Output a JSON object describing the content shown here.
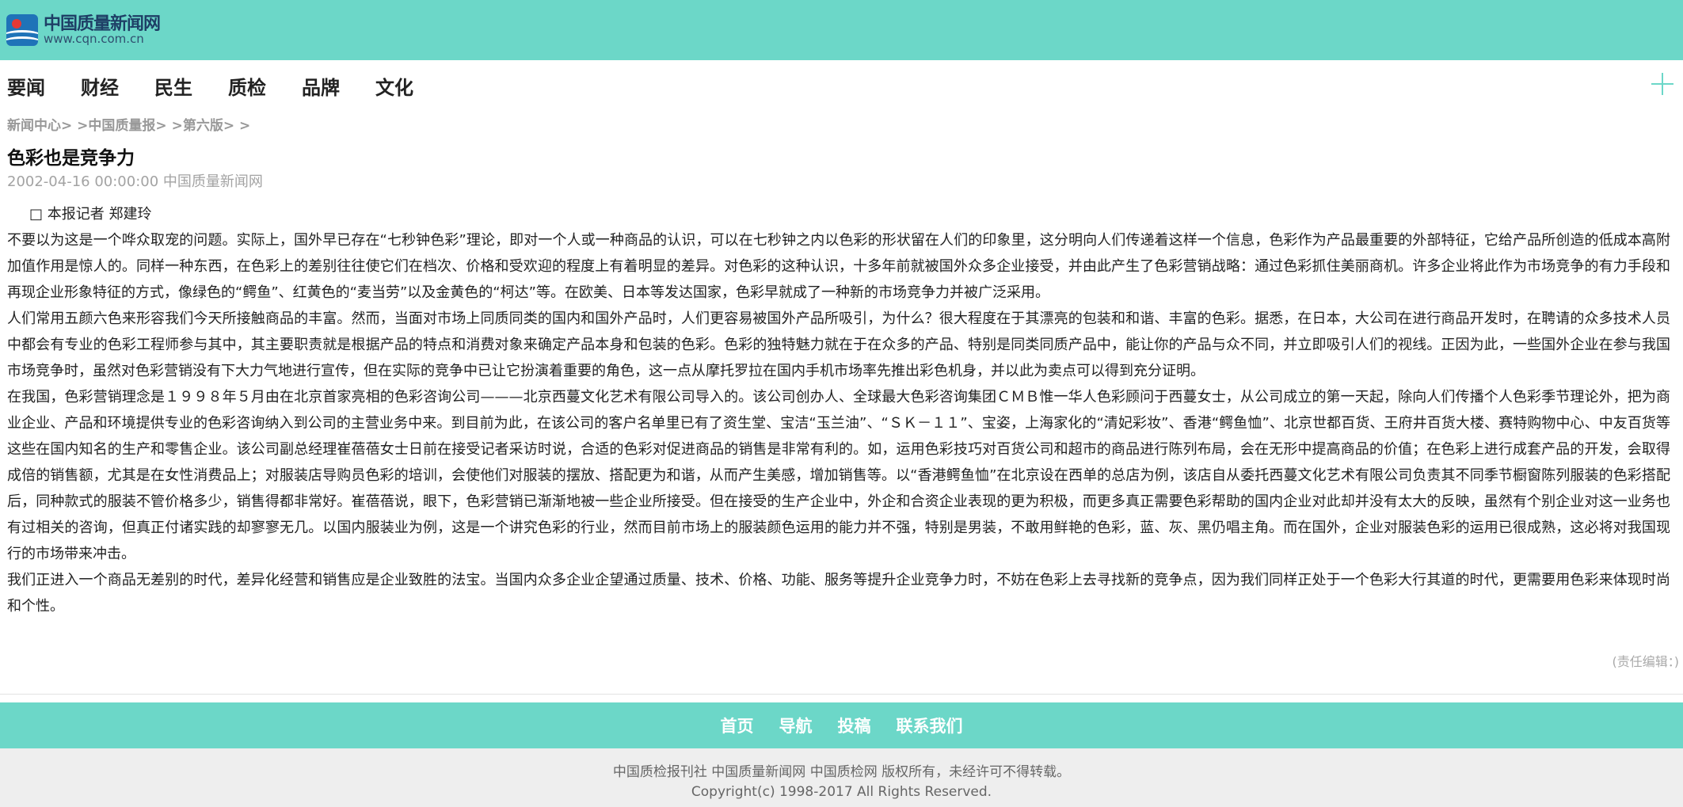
{
  "header": {
    "logo_cn": "中国质量新闻网",
    "logo_url": "www.cqn.com.cn",
    "bg_color": "#6cd7c8"
  },
  "nav": {
    "items": [
      "要闻",
      "财经",
      "民生",
      "质检",
      "品牌",
      "文化"
    ],
    "plus_icon": "plus-icon"
  },
  "breadcrumb": {
    "items": [
      "新闻中心",
      "中国质量报",
      "第六版"
    ],
    "separator": "> >"
  },
  "article": {
    "title": "色彩也是竞争力",
    "meta": "2002-04-16 00:00:00 中国质量新闻网",
    "reporter": "□ 本报记者 郑建玲",
    "paragraphs": [
      "不要以为这是一个哗众取宠的问题。实际上，国外早已存在“七秒钟色彩”理论，即对一个人或一种商品的认识，可以在七秒钟之内以色彩的形状留在人们的印象里，这分明向人们传递着这样一个信息，色彩作为产品最重要的外部特征，它给产品所创造的低成本高附加值作用是惊人的。同样一种东西，在色彩上的差别往往使它们在档次、价格和受欢迎的程度上有着明显的差异。对色彩的这种认识，十多年前就被国外众多企业接受，并由此产生了色彩营销战略：通过色彩抓住美丽商机。许多企业将此作为市场竞争的有力手段和再现企业形象特征的方式，像绿色的“鳄鱼”、红黄色的“麦当劳”以及金黄色的“柯达”等。在欧美、日本等发达国家，色彩早就成了一种新的市场竞争力并被广泛采用。",
      "人们常用五颜六色来形容我们今天所接触商品的丰富。然而，当面对市场上同质同类的国内和国外产品时，人们更容易被国外产品所吸引，为什么？很大程度在于其漂亮的包装和和谐、丰富的色彩。据悉，在日本，大公司在进行商品开发时，在聘请的众多技术人员中都会有专业的色彩工程师参与其中，其主要职责就是根据产品的特点和消费对象来确定产品本身和包装的色彩。色彩的独特魅力就在于在众多的产品、特别是同类同质产品中，能让你的产品与众不同，并立即吸引人们的视线。正因为此，一些国外企业在参与我国市场竞争时，虽然对色彩营销没有下大力气地进行宣传，但在实际的竞争中已让它扮演着重要的角色，这一点从摩托罗拉在国内手机市场率先推出彩色机身，并以此为卖点可以得到充分证明。",
      "在我国，色彩营销理念是１９９８年５月由在北京首家亮相的色彩咨询公司———北京西蔓文化艺术有限公司导入的。该公司创办人、全球最大色彩咨询集团ＣＭＢ惟一华人色彩顾问于西蔓女士，从公司成立的第一天起，除向人们传播个人色彩季节理论外，把为商业企业、产品和环境提供专业的色彩咨询纳入到公司的主营业务中来。到目前为此，在该公司的客户名单里已有了资生堂、宝洁“玉兰油”、“ＳＫ－１１”、宝姿，上海家化的“清妃彩妆”、香港“鳄鱼恤”、北京世都百货、王府井百货大楼、赛特购物中心、中友百货等这些在国内知名的生产和零售企业。该公司副总经理崔蓓蓓女士日前在接受记者采访时说，合适的色彩对促进商品的销售是非常有利的。如，运用色彩技巧对百货公司和超市的商品进行陈列布局，会在无形中提高商品的价值；在色彩上进行成套产品的开发，会取得成倍的销售额，尤其是在女性消费品上；对服装店导购员色彩的培训，会使他们对服装的摆放、搭配更为和谐，从而产生美感，增加销售等。以“香港鳄鱼恤”在北京设在西单的总店为例，该店自从委托西蔓文化艺术有限公司负责其不同季节橱窗陈列服装的色彩搭配后，同种款式的服装不管价格多少，销售得都非常好。崔蓓蓓说，眼下，色彩营销已渐渐地被一些企业所接受。但在接受的生产企业中，外企和合资企业表现的更为积极，而更多真正需要色彩帮助的国内企业对此却并没有太大的反映，虽然有个别企业对这一业务也有过相关的咨询，但真正付诸实践的却寥寥无几。以国内服装业为例，这是一个讲究色彩的行业，然而目前市场上的服装颜色运用的能力并不强，特别是男装，不敢用鲜艳的色彩，蓝、灰、黑仍唱主角。而在国外，企业对服装色彩的运用已很成熟，这必将对我国现行的市场带来冲击。",
      "我们正进入一个商品无差别的时代，差异化经营和销售应是企业致胜的法宝。当国内众多企业企望通过质量、技术、价格、功能、服务等提升企业竞争力时，不妨在色彩上去寻找新的竞争点，因为我们同样正处于一个色彩大行其道的时代，更需要用色彩来体现时尚和个性。"
    ],
    "editor": "(责任编辑：)"
  },
  "footer": {
    "links": [
      "首页",
      "导航",
      "投稿",
      "联系我们"
    ],
    "line1": "中国质检报刊社 中国质量新闻网 中国质检网 版权所有，未经许可不得转载。",
    "line2": "Copyright(c) 1998-2017 All Rights Reserved."
  }
}
